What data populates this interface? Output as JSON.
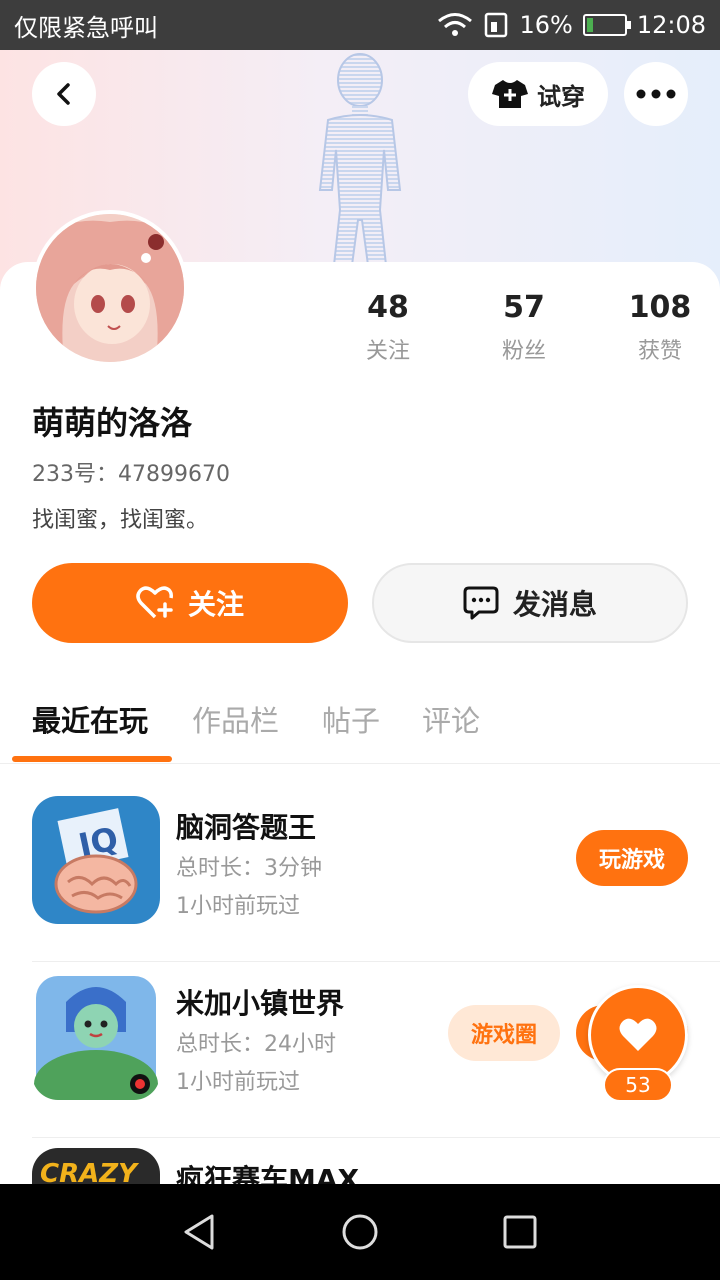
{
  "status_bar": {
    "carrier": "仅限紧急呼叫",
    "battery": "16%",
    "battery_level": 0.16,
    "time": "12:08"
  },
  "header": {
    "try_on_label": "试穿"
  },
  "profile": {
    "name": "萌萌的洛洛",
    "uid": "233号：47899670",
    "bio": "找闺蜜，找闺蜜。",
    "stats": [
      {
        "value": "48",
        "label": "关注"
      },
      {
        "value": "57",
        "label": "粉丝"
      },
      {
        "value": "108",
        "label": "获赞"
      }
    ]
  },
  "actions": {
    "follow_label": "关注",
    "message_label": "发消息"
  },
  "tabs": [
    {
      "label": "最近在玩",
      "active": true
    },
    {
      "label": "作品栏",
      "active": false
    },
    {
      "label": "帖子",
      "active": false
    },
    {
      "label": "评论",
      "active": false
    }
  ],
  "games": [
    {
      "title": "脑洞答题王",
      "duration": "总时长：3分钟",
      "last_played": "1小时前玩过",
      "button": "玩游戏"
    },
    {
      "title": "米加小镇世界",
      "duration": "总时长：24小时",
      "last_played": "1小时前玩过",
      "button": "游戏圈"
    },
    {
      "title": "疯狂赛车MAX",
      "duration": "",
      "last_played": "",
      "button": ""
    }
  ],
  "fab": {
    "count": "53"
  },
  "colors": {
    "accent": "#ff7210"
  }
}
